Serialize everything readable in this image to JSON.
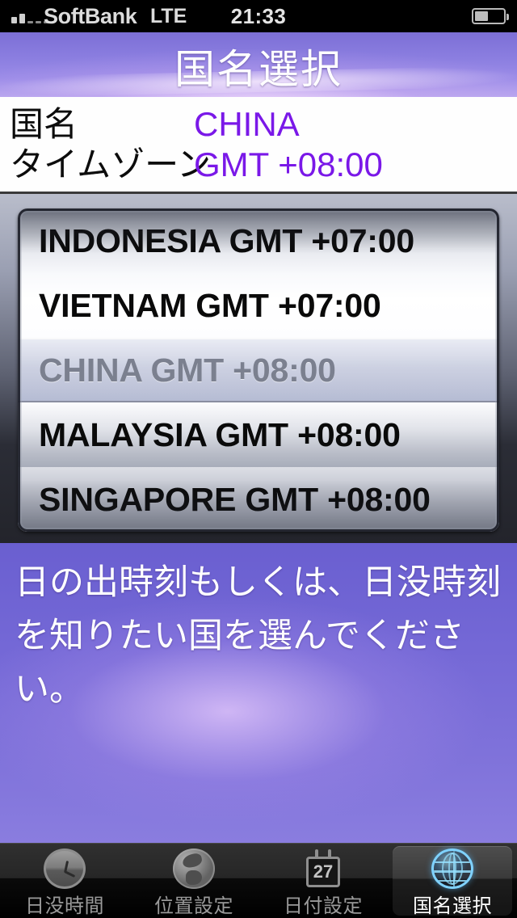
{
  "status_bar": {
    "carrier": "SoftBank",
    "network": "LTE",
    "time": "21:33",
    "signal_icon": "signal-bars-icon",
    "battery_icon": "battery-icon"
  },
  "header": {
    "title": "国名選択"
  },
  "info": {
    "country_label": "国名",
    "country_value": "CHINA",
    "timezone_label": "タイムゾーン",
    "timezone_value": "GMT +08:00",
    "value_color": "#7a18e8"
  },
  "picker": {
    "selected_index": 2,
    "rows": [
      {
        "label": "INDONESIA GMT +07:00"
      },
      {
        "label": "VIETNAM GMT +07:00"
      },
      {
        "label": "CHINA GMT +08:00"
      },
      {
        "label": "MALAYSIA GMT +08:00"
      },
      {
        "label": "SINGAPORE GMT +08:00"
      }
    ]
  },
  "instruction": {
    "text": "日の出時刻もしくは、日没時刻を知りたい国を選んでください。"
  },
  "tab_bar": {
    "calendar_day": "27",
    "active_index": 3,
    "items": [
      {
        "label": "日没時間",
        "icon": "clock-icon"
      },
      {
        "label": "位置設定",
        "icon": "globe-icon"
      },
      {
        "label": "日付設定",
        "icon": "calendar-icon"
      },
      {
        "label": "国名選択",
        "icon": "wireframe-globe-icon"
      }
    ]
  }
}
